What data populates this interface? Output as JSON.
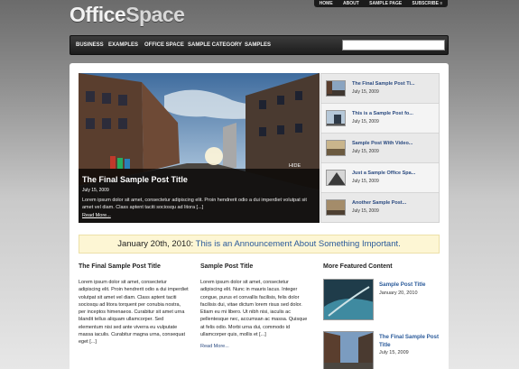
{
  "logo": {
    "office": "Office",
    "space": "Space"
  },
  "top_nav": [
    "HOME",
    "ABOUT",
    "SAMPLE PAGE",
    "SUBSCRIBE"
  ],
  "main_nav": [
    "BUSINESS",
    "EXAMPLES",
    "OFFICE SPACE",
    "SAMPLE CATEGORY",
    "SAMPLES"
  ],
  "search": {
    "placeholder": ""
  },
  "featured": {
    "title": "The Final Sample Post Title",
    "date": "July 15, 2009",
    "excerpt": "Lorem ipsum dolor sit amet, consectetur adipiscing elit. Proin hendrerit odio a dui imperdiet volutpat sit amet vel diam. Class aptent taciti sociosqu ad litora [...]",
    "read_more": "Read More...",
    "hide": "HIDE"
  },
  "thumb_list": [
    {
      "title": "The Final Sample Post Ti...",
      "date": "July 15, 2009"
    },
    {
      "title": "This is a Sample Post fo...",
      "date": "July 15, 2009"
    },
    {
      "title": "Sample Post With Video...",
      "date": "July 15, 2009"
    },
    {
      "title": "Just a Sample Office Spa...",
      "date": "July 15, 2009"
    },
    {
      "title": "Another Sample Post...",
      "date": "July 15, 2009"
    }
  ],
  "announcement": {
    "date": "January 20th, 2010:",
    "text": "This is an Announcement About Something Important."
  },
  "col1": {
    "title": "The Final Sample Post Title",
    "excerpt": "Lorem ipsum dolor sit amet, consectetur adipiscing elit. Proin hendrerit odio a dui imperdiet volutpat sit amet vel diam. Class aptent taciti sociosqu ad litora torquent per conubia nostra, per inceptos himenaeos. Curabitur sit amet urna blandit tellus aliquam ullamcorper. Sed elementum nisi sed ante viverra eu vulputate massa iaculis. Curabitur magna urna, consequat eget [...]"
  },
  "col2": {
    "title": "Sample Post Title",
    "excerpt": "Lorem ipsum dolor sit amet, consectetur adipiscing elit. Nunc in mauris lacus. Integer congue, purus et convallis facilisis, felis dolor facilisis dui, vitae dictum lorem risus sed dolor. Etiam eu mi libero. Ut nibh nisi, iaculis ac pellentesque nec, accumsan ac massa. Quisque at felis odio. Morbi urna dui, commodo id ullamcorper quis, mollis et [...]",
    "read_more": "Read More..."
  },
  "more_featured": {
    "heading": "More Featured Content",
    "items": [
      {
        "title": "Sample Post Title",
        "date": "January 20, 2010"
      },
      {
        "title": "The Final Sample Post Title",
        "date": "July 15, 2009"
      }
    ]
  }
}
